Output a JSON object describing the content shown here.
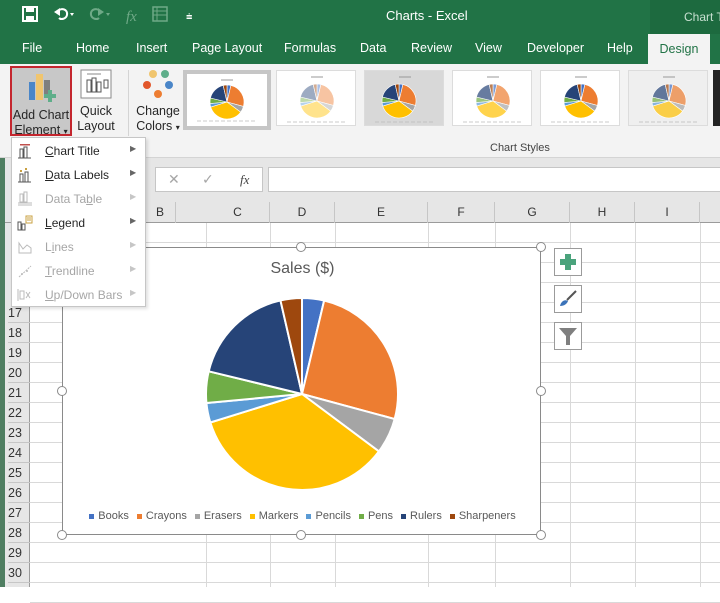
{
  "window": {
    "title": "Charts  -  Excel",
    "contextual_tab_group": "Chart Tools"
  },
  "quick_access": {
    "items": [
      {
        "name": "save",
        "icon": "save-icon",
        "enabled": true
      },
      {
        "name": "undo",
        "icon": "undo-icon",
        "enabled": true
      },
      {
        "name": "redo",
        "icon": "redo-icon",
        "enabled": false
      },
      {
        "name": "insert-function",
        "icon": "fx-icon",
        "enabled": false
      },
      {
        "name": "form",
        "icon": "form-icon",
        "enabled": false
      },
      {
        "name": "customize",
        "icon": "customize-qat-icon",
        "enabled": true
      }
    ]
  },
  "tabs": [
    "File",
    "Home",
    "Insert",
    "Page Layout",
    "Formulas",
    "Data",
    "Review",
    "View",
    "Developer",
    "Help",
    "Design"
  ],
  "active_tab": "Design",
  "ribbon": {
    "add_chart_element": {
      "line1": "Add Chart",
      "line2": "Element"
    },
    "quick_layout": {
      "line1": "Quick",
      "line2": "Layout"
    },
    "change_colors": {
      "line1": "Change",
      "line2": "Colors"
    },
    "chart_styles_label": "Chart Styles",
    "style_thumbnails": [
      "Style 1",
      "Style 2",
      "Style 3",
      "Style 4",
      "Style 5",
      "Style 6",
      "Style 7"
    ]
  },
  "dropdown_menu": {
    "items": [
      {
        "label": "Chart Title",
        "underline": "C",
        "rest": "hart Title",
        "enabled": true,
        "icon": "chart-title-icon"
      },
      {
        "label": "Data Labels",
        "underline": "D",
        "rest": "ata Labels",
        "enabled": true,
        "icon": "data-labels-icon"
      },
      {
        "label": "Data Table",
        "pre": "Data Ta",
        "underline": "b",
        "rest": "le",
        "enabled": false,
        "icon": "data-table-icon"
      },
      {
        "label": "Legend",
        "underline": "L",
        "rest": "egend",
        "enabled": true,
        "icon": "legend-icon"
      },
      {
        "label": "Lines",
        "pre": "L",
        "underline": "i",
        "rest": "nes",
        "enabled": false,
        "icon": "lines-icon"
      },
      {
        "label": "Trendline",
        "underline": "T",
        "rest": "rendline",
        "enabled": false,
        "icon": "trendline-icon"
      },
      {
        "label": "Up/Down Bars",
        "underline": "U",
        "rest": "p/Down Bars",
        "enabled": false,
        "icon": "up-down-bars-icon"
      }
    ]
  },
  "formula_bar": {
    "cancel": "✕",
    "enter": "✓",
    "fx": "fx",
    "value": ""
  },
  "columns": [
    "B",
    "C",
    "D",
    "E",
    "F",
    "G",
    "H",
    "I"
  ],
  "rows": [
    "17",
    "18",
    "19",
    "20",
    "21",
    "22",
    "23",
    "24",
    "25",
    "26",
    "27",
    "28",
    "29",
    "30"
  ],
  "chart_side_buttons": [
    {
      "name": "chart-elements",
      "icon": "plus-icon"
    },
    {
      "name": "chart-styles",
      "icon": "paintbrush-icon"
    },
    {
      "name": "chart-filters",
      "icon": "filter-icon"
    }
  ],
  "chart_data": {
    "type": "pie",
    "title": "Sales ($)",
    "legend_position": "bottom",
    "categories": [
      "Books",
      "Crayons",
      "Erasers",
      "Markers",
      "Pencils",
      "Pens",
      "Rulers",
      "Sharpeners"
    ],
    "values": [
      3.7,
      25.5,
      6.0,
      35.0,
      3.3,
      5.3,
      17.6,
      3.6
    ],
    "value_units": "percent of total (estimated)",
    "colors": [
      "#4472c4",
      "#ed7d31",
      "#a5a5a5",
      "#ffc000",
      "#5b9bd5",
      "#70ad47",
      "#264478",
      "#9e480e"
    ],
    "start_angle_deg": 0,
    "direction": "clockwise"
  }
}
